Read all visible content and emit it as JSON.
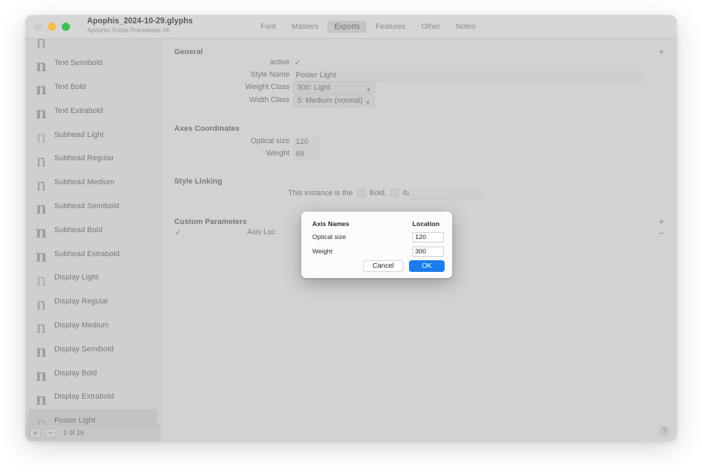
{
  "window": {
    "title": "Apophis_2024-10-29.glyphs",
    "subtitle": "Apophis Sreda Prerelease 06",
    "traffic": {
      "close": "close-button",
      "minimize": "minimize-button",
      "zoom": "zoom-button"
    }
  },
  "tabs": [
    {
      "label": "Font",
      "selected": false
    },
    {
      "label": "Masters",
      "selected": false
    },
    {
      "label": "Exports",
      "selected": true
    },
    {
      "label": "Features",
      "selected": false
    },
    {
      "label": "Other",
      "selected": false
    },
    {
      "label": "Notes",
      "selected": false
    }
  ],
  "sidebar": {
    "glyph_preview": "n",
    "instances": [
      {
        "label": "Text Semibold",
        "weight": 600,
        "selected": false
      },
      {
        "label": "Text Bold",
        "weight": 700,
        "selected": false
      },
      {
        "label": "Text Extrabold",
        "weight": 800,
        "selected": false
      },
      {
        "label": "Subhead Light",
        "weight": 300,
        "selected": false
      },
      {
        "label": "Subhead Regular",
        "weight": 400,
        "selected": false
      },
      {
        "label": "Subhead Medium",
        "weight": 500,
        "selected": false
      },
      {
        "label": "Subhead Semibold",
        "weight": 600,
        "selected": false
      },
      {
        "label": "Subhead Bold",
        "weight": 700,
        "selected": false
      },
      {
        "label": "Subhead Extrabold",
        "weight": 800,
        "selected": false
      },
      {
        "label": "Display Light",
        "weight": 300,
        "selected": false
      },
      {
        "label": "Display Regular",
        "weight": 400,
        "selected": false
      },
      {
        "label": "Display Medium",
        "weight": 500,
        "selected": false
      },
      {
        "label": "Display Semibold",
        "weight": 600,
        "selected": false
      },
      {
        "label": "Display Bold",
        "weight": 700,
        "selected": false
      },
      {
        "label": "Display Extrabold",
        "weight": 800,
        "selected": false
      },
      {
        "label": "Poster Light",
        "weight": 300,
        "selected": true
      }
    ],
    "footer": {
      "add_label": "+",
      "remove_label": "−",
      "count_text": "1 of 26"
    }
  },
  "main": {
    "sections": {
      "general": {
        "title": "General",
        "add_label": "+",
        "active_label": "active",
        "active_checked": true,
        "style_name_label": "Style Name",
        "style_name_value": "Poster Light",
        "weight_class_label": "Weight Class",
        "weight_class_value": "300: Light",
        "width_class_label": "Width Class",
        "width_class_value": "5: Medium (normal)"
      },
      "axes_coordinates": {
        "title": "Axes Coordinates",
        "rows": [
          {
            "label": "Optical size",
            "value": "120"
          },
          {
            "label": "Weight",
            "value": "68"
          }
        ]
      },
      "style_linking": {
        "title": "Style Linking",
        "prefix": "This instance is the",
        "bold_label": "Bold,",
        "bold_checked": false,
        "italic_label": "Italic of",
        "italic_checked": false,
        "linked_value": ""
      },
      "custom_parameters": {
        "title": "Custom Parameters",
        "add_label": "+",
        "remove_label": "−",
        "rows": [
          {
            "checked": true,
            "name": "Axis Loc"
          }
        ]
      }
    },
    "help_label": "?"
  },
  "dialog": {
    "headers": {
      "names": "Axis Names",
      "location": "Location"
    },
    "rows": [
      {
        "name": "Optical size",
        "location": "120"
      },
      {
        "name": "Weight",
        "location": "300"
      }
    ],
    "cancel_label": "Cancel",
    "ok_label": "OK",
    "accent_color": "#1a7ced"
  }
}
